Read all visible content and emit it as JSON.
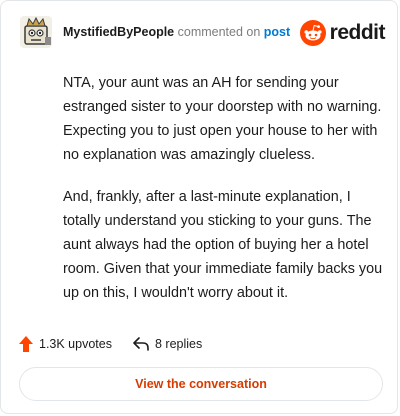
{
  "header": {
    "username": "MystifiedByPeople",
    "action_text": " commented on ",
    "post_link": "post",
    "brand": "reddit",
    "brand_color": "#ff4500"
  },
  "comment": {
    "paragraphs": [
      "NTA, your aunt was an AH for sending your estranged sister to your doorstep with no warning. Expecting you to just open your house to her with no explanation was amazingly clueless.",
      "And, frankly, after a last-minute explanation, I totally understand you sticking to your guns. The aunt always had the option of buying her a hotel room. Given that your immediate family backs you up on this, I wouldn't worry about it."
    ]
  },
  "footer": {
    "upvotes": "1.3K upvotes",
    "replies": "8 replies",
    "upvote_icon": "upvote-arrow-icon",
    "reply_icon": "reply-arrow-icon",
    "upvote_color": "#ff4500"
  },
  "cta": {
    "label": "View the conversation",
    "color": "#d93a00"
  }
}
